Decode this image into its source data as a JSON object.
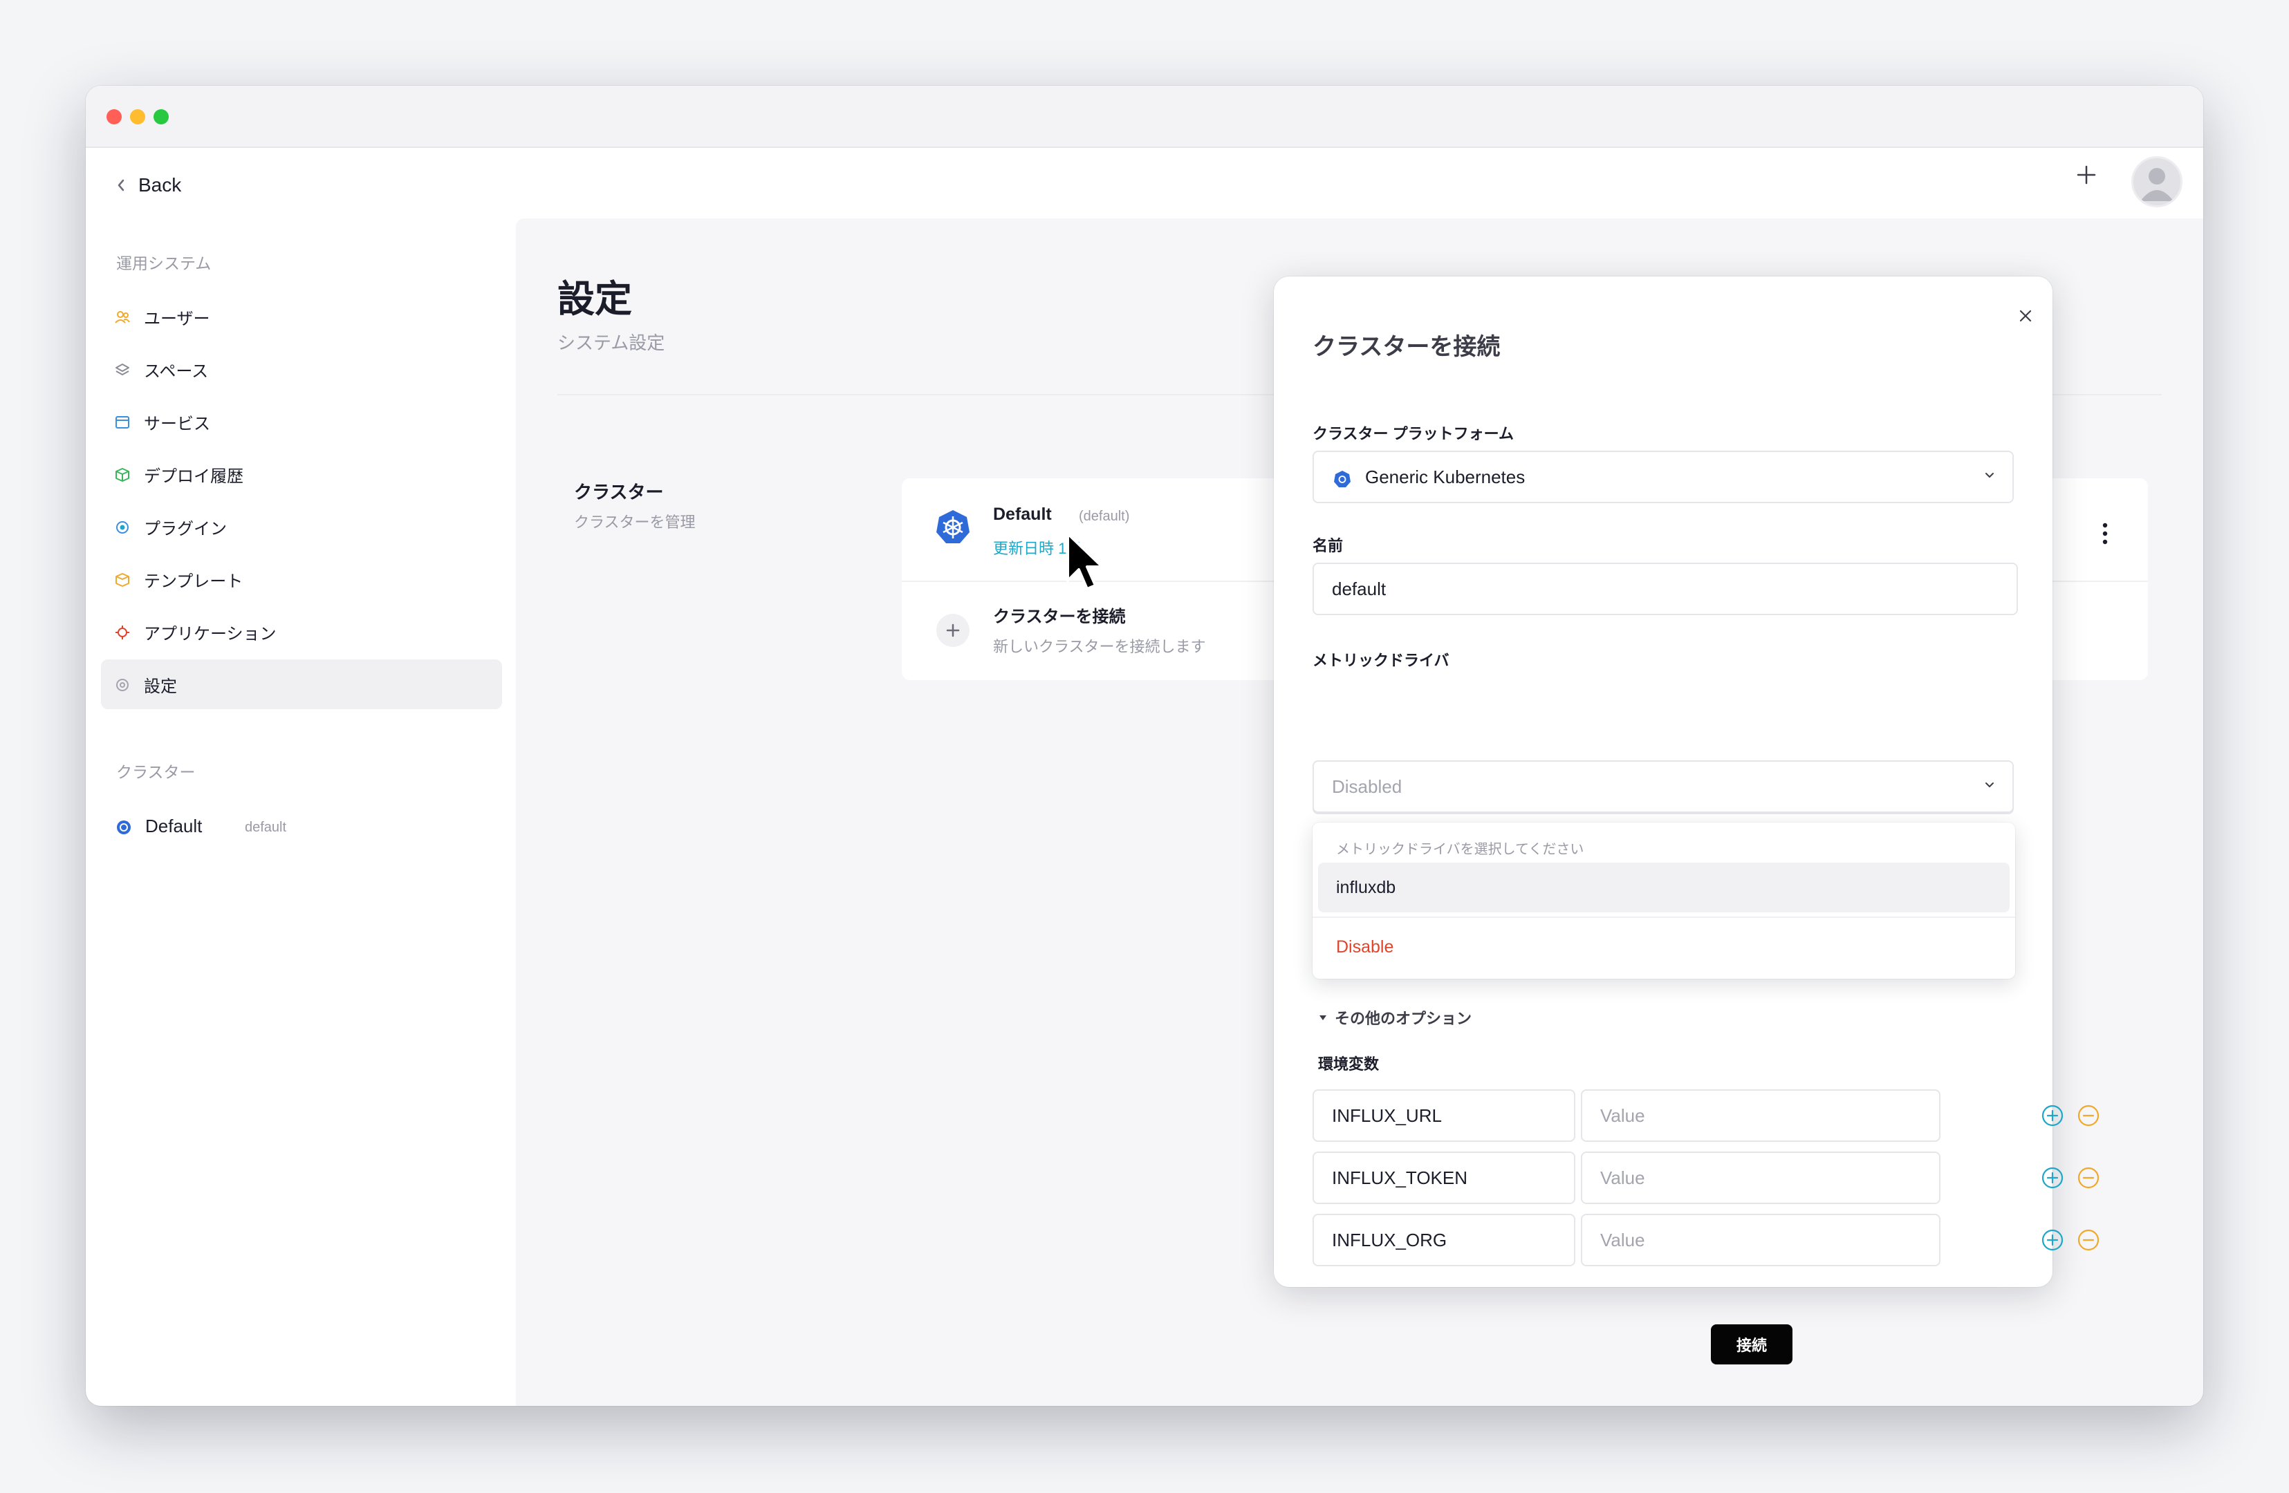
{
  "nav": {
    "back_label": "Back",
    "section_ops": "運用システム",
    "items": [
      {
        "label": "ユーザー",
        "icon": "users-icon"
      },
      {
        "label": "スペース",
        "icon": "layers-icon"
      },
      {
        "label": "サービス",
        "icon": "window-icon"
      },
      {
        "label": "デプロイ履歴",
        "icon": "box-icon"
      },
      {
        "label": "プラグイン",
        "icon": "plugin-icon"
      },
      {
        "label": "テンプレート",
        "icon": "template-icon"
      },
      {
        "label": "アプリケーション",
        "icon": "app-icon"
      },
      {
        "label": "設定",
        "icon": "settings-icon"
      }
    ],
    "active_index": 7,
    "section_cluster": "クラスター",
    "cluster": {
      "name": "Default",
      "tag": "default"
    }
  },
  "page": {
    "title": "設定",
    "subtitle": "システム設定",
    "section_title": "クラスター",
    "section_sub": "クラスターを管理",
    "cluster_card": {
      "name": "Default",
      "tag": "(default)",
      "link": "更新日時 1日",
      "connect_title": "クラスターを接続",
      "connect_sub": "新しいクラスターを接続します"
    }
  },
  "modal": {
    "title": "クラスターを接続",
    "platform_label": "クラスター プラットフォーム",
    "platform_value": "Generic Kubernetes",
    "name_label": "名前",
    "name_value": "default",
    "driver_label": "メトリックドライバ",
    "driver_value": "Disabled",
    "dropdown": {
      "header": "メトリックドライバを選択してください",
      "options": [
        "influxdb",
        "Disable"
      ]
    },
    "more_options": "その他のオプション",
    "env_label": "環境変数",
    "env": [
      {
        "key": "INFLUX_URL",
        "value_placeholder": "Value"
      },
      {
        "key": "INFLUX_TOKEN",
        "value_placeholder": "Value"
      },
      {
        "key": "INFLUX_ORG",
        "value_placeholder": "Value"
      }
    ],
    "submit_label": "接続"
  },
  "colors": {
    "accent_blue": "#2f6bd8",
    "link_cyan": "#1ea7c9",
    "add_icon": "#1ea7c9",
    "remove_icon": "#f0a92a",
    "danger": "#e0452b"
  }
}
